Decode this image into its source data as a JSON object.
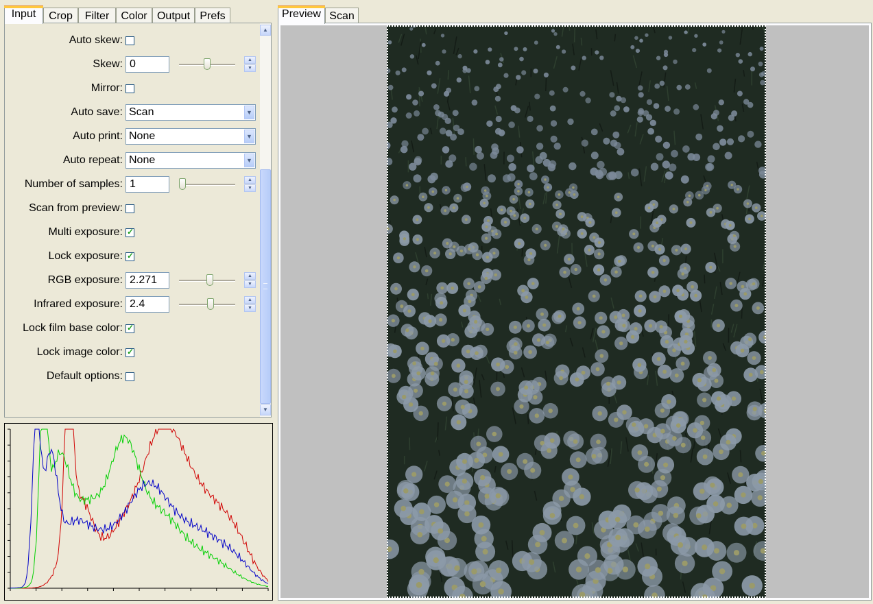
{
  "left_tabs": [
    "Input",
    "Crop",
    "Filter",
    "Color",
    "Output",
    "Prefs"
  ],
  "left_active_tab": "Input",
  "right_tabs": [
    "Preview",
    "Scan"
  ],
  "right_active_tab": "Preview",
  "options": {
    "auto_skew": {
      "label": "Auto skew:",
      "checked": false
    },
    "skew": {
      "label": "Skew:",
      "value": "0",
      "slider_fraction": 0.5
    },
    "mirror": {
      "label": "Mirror:",
      "checked": false
    },
    "auto_save": {
      "label": "Auto save:",
      "value": "Scan"
    },
    "auto_print": {
      "label": "Auto print:",
      "value": "None"
    },
    "auto_repeat": {
      "label": "Auto repeat:",
      "value": "None"
    },
    "num_samples": {
      "label": "Number of samples:",
      "value": "1",
      "slider_fraction": 0.0
    },
    "scan_from_preview": {
      "label": "Scan from preview:",
      "checked": false
    },
    "multi_exposure": {
      "label": "Multi exposure:",
      "checked": true
    },
    "lock_exposure": {
      "label": "Lock exposure:",
      "checked": true
    },
    "rgb_exposure": {
      "label": "RGB exposure:",
      "value": "2.271",
      "slider_fraction": 0.56
    },
    "infrared_exposure": {
      "label": "Infrared exposure:",
      "value": "2.4",
      "slider_fraction": 0.57
    },
    "lock_film_base_color": {
      "label": "Lock film base color:",
      "checked": true
    },
    "lock_image_color": {
      "label": "Lock image color:",
      "checked": true
    },
    "default_options": {
      "label": "Default options:",
      "checked": false
    }
  },
  "icons": {
    "checkmark": "✓",
    "dropdown": "▼",
    "spin_up": "▲",
    "spin_down": "▼",
    "scroll_up": "▲",
    "scroll_down": "▼"
  },
  "histogram": {
    "colors": {
      "red": "#D00000",
      "green": "#00D000",
      "blue": "#0000C8"
    }
  }
}
